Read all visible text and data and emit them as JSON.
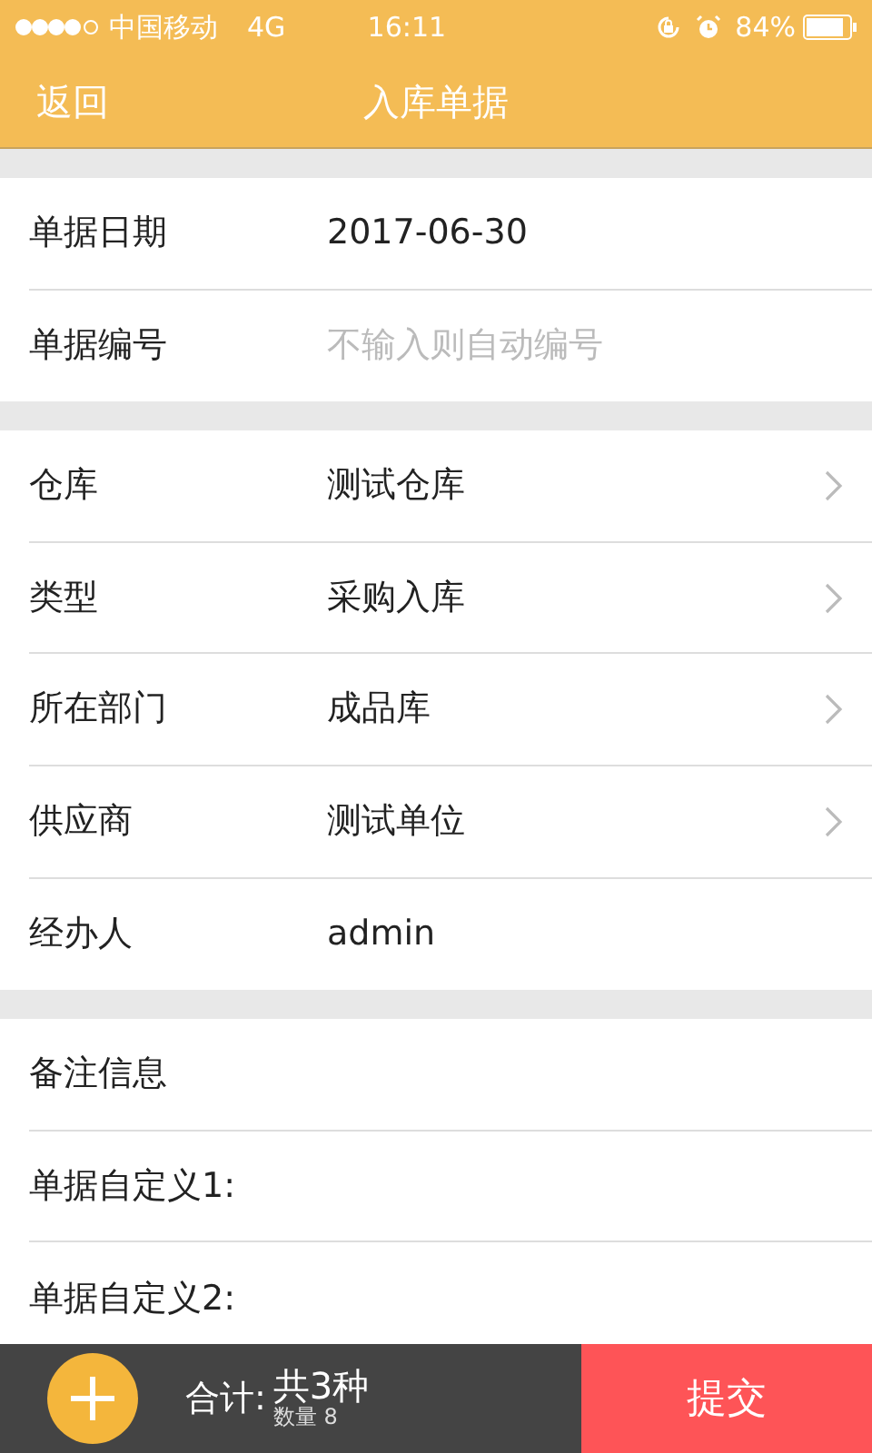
{
  "status_bar": {
    "carrier": "中国移动",
    "network": "4G",
    "time": "16:11",
    "battery": "84%"
  },
  "nav": {
    "back": "返回",
    "title": "入库单据"
  },
  "sections": [
    {
      "rows": [
        {
          "label": "单据日期",
          "kind": "value",
          "value": "2017-06-30"
        },
        {
          "label": "单据编号",
          "kind": "input",
          "placeholder": "不输入则自动编号"
        }
      ]
    },
    {
      "rows": [
        {
          "label": "仓库",
          "kind": "select",
          "value": "测试仓库"
        },
        {
          "label": "类型",
          "kind": "select",
          "value": "采购入库"
        },
        {
          "label": "所在部门",
          "kind": "select",
          "value": "成品库"
        },
        {
          "label": "供应商",
          "kind": "select",
          "value": "测试单位"
        },
        {
          "label": "经办人",
          "kind": "value",
          "value": "admin"
        }
      ]
    },
    {
      "rows": [
        {
          "label": "备注信息",
          "kind": "label"
        },
        {
          "label": "单据自定义1:",
          "kind": "label"
        },
        {
          "label": "单据自定义2:",
          "kind": "label"
        }
      ]
    }
  ],
  "footer": {
    "total_label": "合计:",
    "total": "共3种",
    "quantity": "数量 8",
    "submit": "提交"
  }
}
